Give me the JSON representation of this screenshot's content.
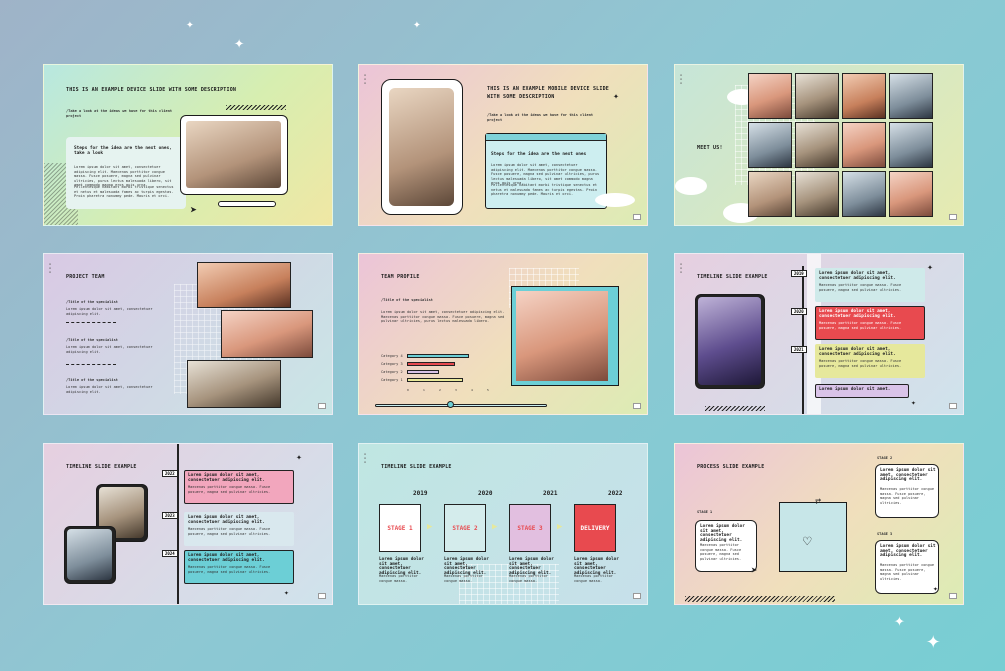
{
  "colors": {
    "background_start": "#9fb3c8",
    "background_end": "#78ced3",
    "accent_pink": "#d8425a",
    "accent_teal": "#6ccfd6",
    "accent_red": "#e84a4f",
    "accent_purple": "#d9c3e8",
    "accent_yellow": "#e8e89a"
  },
  "icons": [
    "sparkle-icon",
    "cursor-icon",
    "heart-icon",
    "arrow-right-icon",
    "cloud-icon"
  ],
  "lorem": "Lorem ipsum dolor sit amet, consectetuer adipiscing elit. Maecenas porttitor congue massa. Fusce posuere, magna sed pulvinar ultricies, purus lectus malesuada libero, sit amet commodo magna eros quis urna.",
  "slides": {
    "s1": {
      "title": "THIS IS AN EXAMPLE DEVICE SLIDE WITH SOME DESCRIPTION",
      "subtitle": "/Take a look at the ideas we have for this client project",
      "card_title": "Steps for the idea are the next ones, take a look",
      "card_body": "Lorem ipsum dolor sit amet, consectetuer adipiscing elit. Maecenas porttitor congue massa. Fusce posuere, magna sed pulvinar ultricies, purus lectus malesuada libero, sit amet commodo magna eros quis urna.",
      "card_body2": "Pellentesque habitant morbi tristique senectus et netus et malesuada fames ac turpis egestas. Proin pharetra nonummy pede. Mauris et orci."
    },
    "s2": {
      "title": "THIS IS AN EXAMPLE MOBILE DEVICE SLIDE WITH SOME DESCRIPTION",
      "subtitle": "/Take a look at the ideas we have for this client project",
      "card_title": "Steps for the idea are the next ones",
      "card_body": "Lorem ipsum dolor sit amet, consectetuer adipiscing elit. Maecenas porttitor congue massa. Fusce posuere, magna sed pulvinar ultricies, purus lectus malesuada libero, sit amet commodo magna eros quis urna.",
      "card_body2": "Pellentesque habitant morbi tristique senectus et netus et malesuada fames ac turpis egestas. Proin pharetra nonummy pede. Mauris et orci."
    },
    "s3": {
      "title": "MEET US!"
    },
    "s4": {
      "title": "PROJECT TEAM",
      "role1": "/Title of the specialist",
      "role2": "/Title of the specialist",
      "role3": "/Title of the specialist",
      "text": "Lorem ipsum dolor sit amet, consectetuer adipiscing elit."
    },
    "s5": {
      "title": "TEAM PROFILE",
      "role": "/Title of the specialist",
      "text": "Lorem ipsum dolor sit amet, consectetuer adipiscing elit. Maecenas porttitor congue massa. Fusce posuere, magna sed pulvinar ultricies, purus lectus malesuada libero.",
      "categories": [
        "Category 4",
        "Category 3",
        "Category 2",
        "Category 1"
      ],
      "category_values": [
        0.78,
        0.6,
        0.4,
        0.7
      ],
      "category_colors": [
        "#6ccfd6",
        "#e84a4f",
        "#d9c3e8",
        "#e8e89a"
      ],
      "scale": [
        "0",
        "1",
        "2",
        "3",
        "4",
        "5"
      ]
    },
    "s6": {
      "title": "TIMELINE SLIDE EXAMPLE",
      "years": [
        "2019",
        "2020",
        "2021"
      ],
      "item": "Lorem ipsum dolor sit amet, consectetuer adipiscing elit.",
      "item_body": "Maecenas porttitor congue massa. Fusce posuere, magna sed pulvinar ultricies.",
      "footer": "Lorem ipsum dolor sit amet."
    },
    "s7": {
      "title": "TIMELINE SLIDE EXAMPLE",
      "years": [
        "2022",
        "2023",
        "2024"
      ],
      "item": "Lorem ipsum dolor sit amet, consectetuer adipiscing elit.",
      "item_body": "Maecenas porttitor congue massa. Fusce posuere, magna sed pulvinar ultricies."
    },
    "s8": {
      "title": "TIMELINE SLIDE EXAMPLE",
      "years": [
        "2019",
        "2020",
        "2021",
        "2022"
      ],
      "stages": [
        "STAGE 1",
        "STAGE 2",
        "STAGE 3",
        "DELIVERY"
      ],
      "stage_text": "Lorem ipsum dolor sit amet, consectetuer adipiscing elit.",
      "stage_text2": "Maecenas porttitor congue massa."
    },
    "s9": {
      "title": "PROCESS SLIDE EXAMPLE",
      "stages": [
        "STAGE 1",
        "STAGE 2",
        "STAGE 3"
      ],
      "text": "Lorem ipsum dolor sit amet, consectetuer adipiscing elit.",
      "text2": "Maecenas porttitor congue massa. Fusce posuere, magna sed pulvinar ultricies."
    }
  }
}
